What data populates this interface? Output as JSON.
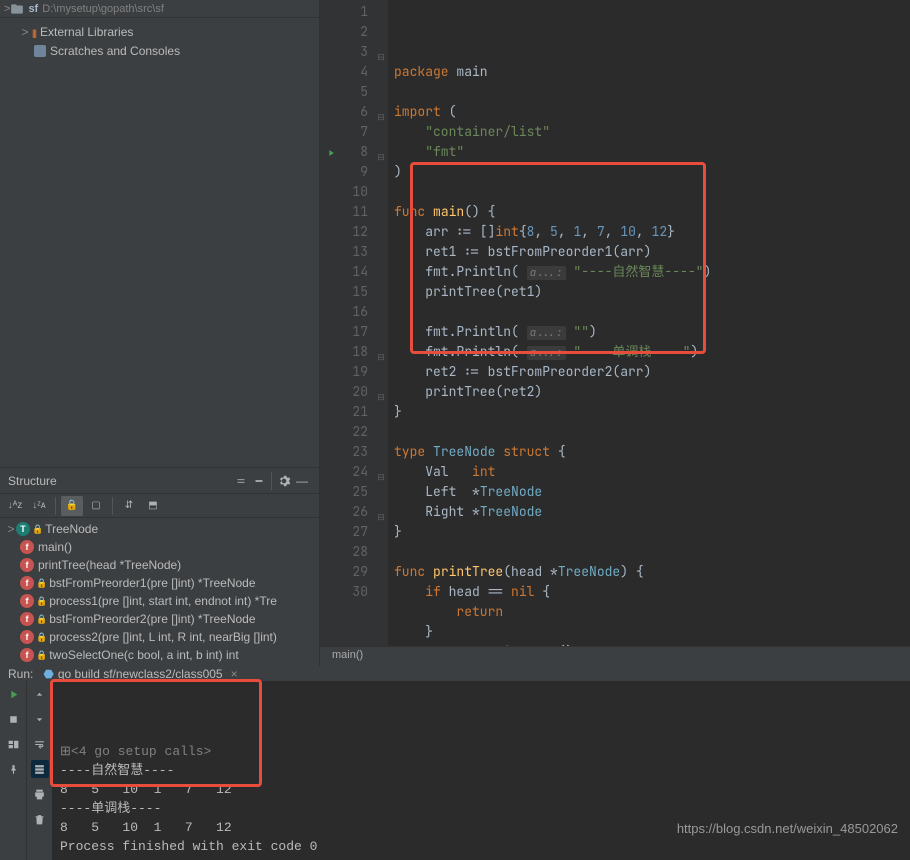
{
  "breadcrumb": {
    "folder": "sf",
    "path": "D:\\mysetup\\gopath\\src\\sf"
  },
  "project_tree": {
    "ext_libs": "External Libraries",
    "scratches": "Scratches and Consoles"
  },
  "structure": {
    "title": "Structure",
    "items": [
      {
        "kind": "t",
        "label": "TreeNode",
        "expandable": true
      },
      {
        "kind": "f",
        "label": "main()",
        "lock": false
      },
      {
        "kind": "f",
        "label": "printTree(head *TreeNode)",
        "lock": false
      },
      {
        "kind": "f",
        "label": "bstFromPreorder1(pre []int) *TreeNode",
        "lock": true
      },
      {
        "kind": "f",
        "label": "process1(pre []int, start int, endnot int) *Tre",
        "lock": true
      },
      {
        "kind": "f",
        "label": "bstFromPreorder2(pre []int) *TreeNode",
        "lock": true
      },
      {
        "kind": "f",
        "label": "process2(pre []int, L int, R int, nearBig []int)",
        "lock": true
      },
      {
        "kind": "f",
        "label": "twoSelectOne(c bool, a int, b int) int",
        "lock": true
      }
    ]
  },
  "editor": {
    "lines": [
      {
        "n": 1,
        "html": "<span class='kw'>package</span> main"
      },
      {
        "n": 2,
        "html": ""
      },
      {
        "n": 3,
        "html": "<span class='kw'>import</span> (",
        "fold": "⊟"
      },
      {
        "n": 4,
        "html": "    <span class='str'>\"container/list\"</span>"
      },
      {
        "n": 5,
        "html": "    <span class='str'>\"fmt\"</span>"
      },
      {
        "n": 6,
        "html": ")",
        "fold": "⊟"
      },
      {
        "n": 7,
        "html": ""
      },
      {
        "n": 8,
        "html": "<span class='kw'>func</span> <span class='fn'>main</span>() {",
        "fold": "⊟",
        "run": true
      },
      {
        "n": 9,
        "html": "    arr := []<span class='kw'>int</span>{<span class='num'>8</span>, <span class='num'>5</span>, <span class='num'>1</span>, <span class='num'>7</span>, <span class='num'>10</span>, <span class='num'>12</span>}"
      },
      {
        "n": 10,
        "html": "    ret1 := bstFromPreorder1(arr)"
      },
      {
        "n": 11,
        "html": "    fmt.Println( <span class='param-hint'>a...:</span> <span class='str'>\"----自然智慧----\"</span>)"
      },
      {
        "n": 12,
        "html": "    printTree(ret1)"
      },
      {
        "n": 13,
        "html": ""
      },
      {
        "n": 14,
        "html": "    fmt.Println( <span class='param-hint'>a...:</span> <span class='str'>\"\"</span>)"
      },
      {
        "n": 15,
        "html": "    fmt.Println( <span class='param-hint'>a...:</span> <span class='str'>\"----单调栈----\"</span>)"
      },
      {
        "n": 16,
        "html": "    ret2 := bstFromPreorder2(arr)"
      },
      {
        "n": 17,
        "html": "    printTree(ret2)"
      },
      {
        "n": 18,
        "html": "}",
        "fold": "⊟"
      },
      {
        "n": 19,
        "html": ""
      },
      {
        "n": 20,
        "html": "<span class='kw'>type</span> <span class='typ'>TreeNode</span> <span class='kw'>struct</span> {",
        "fold": "⊟"
      },
      {
        "n": 21,
        "html": "    Val   <span class='kw'>int</span>"
      },
      {
        "n": 22,
        "html": "    Left  *<span class='typ'>TreeNode</span>"
      },
      {
        "n": 23,
        "html": "    Right *<span class='typ'>TreeNode</span>"
      },
      {
        "n": 24,
        "html": "}",
        "fold": "⊟"
      },
      {
        "n": 25,
        "html": ""
      },
      {
        "n": 26,
        "html": "<span class='kw'>func</span> <span class='fn'>printTree</span>(head *<span class='typ'>TreeNode</span>) {",
        "fold": "⊟"
      },
      {
        "n": 27,
        "html": "    <span class='kw'>if</span> head == <span class='kw'>nil</span> {"
      },
      {
        "n": 28,
        "html": "        <span class='kw'>return</span>"
      },
      {
        "n": 29,
        "html": "    }"
      },
      {
        "n": 30,
        "html": "    queue := list.New()"
      }
    ],
    "breadcrumb": "main()"
  },
  "run": {
    "title": "Run:",
    "tab": "go build sf/newclass2/class005",
    "setup_calls": "<4 go setup calls>",
    "output": [
      "----自然智慧----",
      "8   5   10  1   7   12",
      "----单调栈----",
      "8   5   10  1   7   12"
    ],
    "exit": "Process finished with exit code 0"
  },
  "watermark": "https://blog.csdn.net/weixin_48502062"
}
